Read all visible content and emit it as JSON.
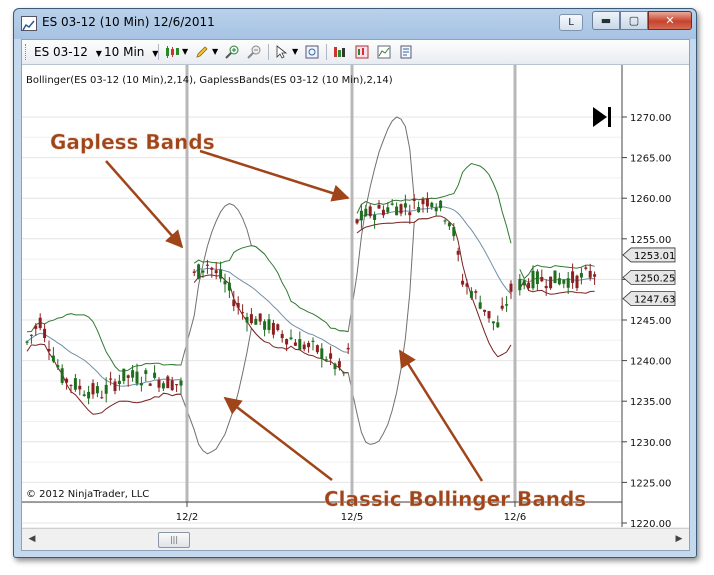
{
  "window": {
    "title": "ES 03-12 (10 Min)  12/6/2011",
    "l_button": "L"
  },
  "toolbar": {
    "instrument": "ES 03-12",
    "interval": "10 Min"
  },
  "chart": {
    "indicator_label": "Bollinger(ES 03-12 (10 Min),2,14), GaplessBands(ES 03-12 (10 Min),2,14)",
    "copyright": "© 2012 NinjaTrader, LLC",
    "price_axis": [
      "1270.00",
      "1265.00",
      "1260.00",
      "1255.00",
      "1250.00",
      "1245.00",
      "1240.00",
      "1235.00",
      "1230.00",
      "1225.00",
      "1220.00"
    ],
    "date_axis": [
      "12/2",
      "12/5",
      "12/6"
    ],
    "price_markers": [
      {
        "label": "1253.01",
        "value": 1253.01,
        "color": "#e6e6e6"
      },
      {
        "label": "1250.25",
        "value": 1250.25,
        "color": "#e6e6e6"
      },
      {
        "label": "1247.63",
        "value": 1247.63,
        "color": "#e6e6e6"
      }
    ],
    "annotations": {
      "gapless": "Gapless Bands",
      "classic": "Classic Bollinger Bands"
    },
    "colors": {
      "annotation": "#a0451a",
      "upper_band": "#2f7a2f",
      "lower_band": "#7a2222",
      "middle_band": "#6f8fa8",
      "classic_band": "#707070",
      "candle_up": "#1e6e1e",
      "candle_down": "#8c1f1f"
    }
  }
}
